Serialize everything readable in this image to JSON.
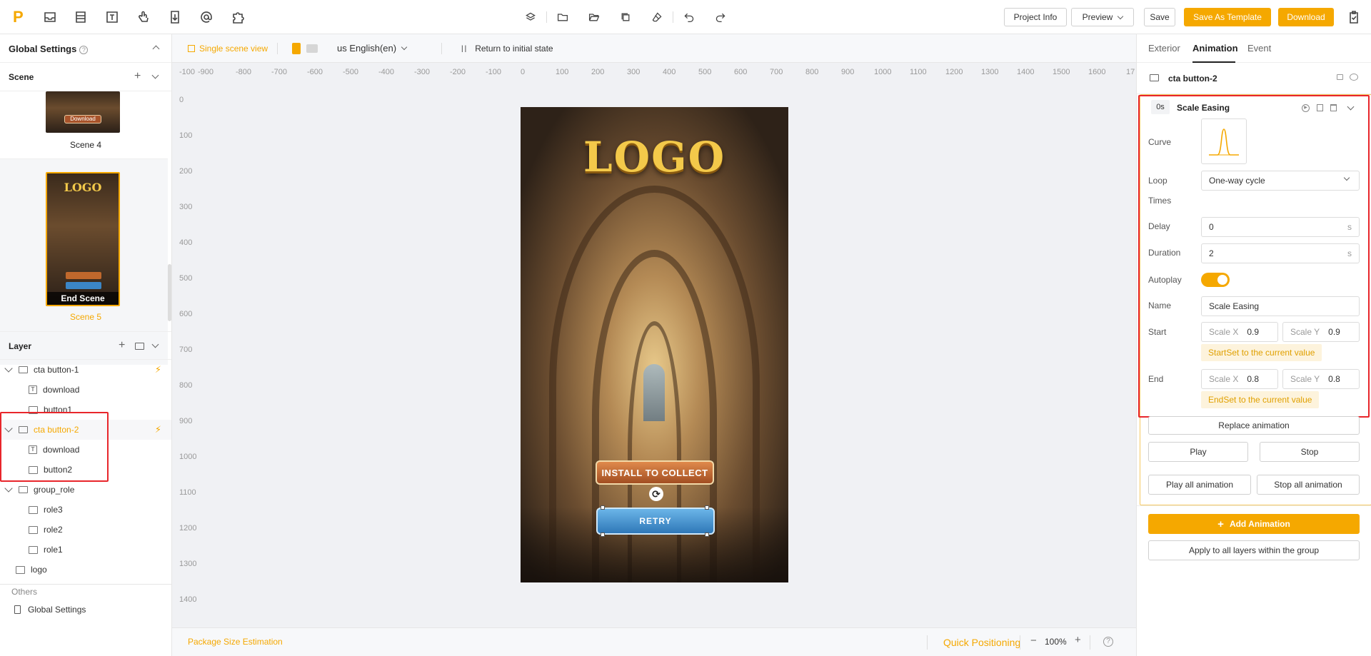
{
  "topbar": {
    "logo": "P",
    "project_info": "Project Info",
    "preview": "Preview",
    "save": "Save",
    "save_as_template": "Save As Template",
    "download": "Download"
  },
  "left": {
    "global_settings": "Global Settings",
    "scene_header": "Scene",
    "scenes": [
      {
        "label": "Scene 4",
        "badge": "Download"
      },
      {
        "label": "Scene 5",
        "badge": "End Scene",
        "logo": "LOGO"
      }
    ],
    "layer_header": "Layer",
    "layers": [
      {
        "label": "cta button-1"
      },
      {
        "label": "download"
      },
      {
        "label": "button1"
      },
      {
        "label": "cta button-2"
      },
      {
        "label": "download"
      },
      {
        "label": "button2"
      },
      {
        "label": "group_role"
      },
      {
        "label": "role3"
      },
      {
        "label": "role2"
      },
      {
        "label": "role1"
      },
      {
        "label": "logo"
      }
    ],
    "others_header": "Others",
    "others_item": "Global Settings"
  },
  "canvas": {
    "single_scene_view": "Single scene view",
    "language": "us English(en)",
    "return_initial": "Return to initial state",
    "ruler_h": [
      "-100",
      "-900",
      "-800",
      "-700",
      "-600",
      "-500",
      "-400",
      "-300",
      "-200",
      "-100",
      "0",
      "100",
      "200",
      "300",
      "400",
      "500",
      "600",
      "700",
      "800",
      "900",
      "1000",
      "1100",
      "1200",
      "1300",
      "1400",
      "1500",
      "1600",
      "17"
    ],
    "ruler_v": [
      "0",
      "100",
      "200",
      "300",
      "400",
      "500",
      "600",
      "700",
      "800",
      "900",
      "1000",
      "1100",
      "1200",
      "1300",
      "1400"
    ],
    "phone_logo": "LOGO",
    "install_btn": "INSTALL TO COLLECT",
    "retry_btn": "RETRY",
    "package_size": "Package Size Estimation",
    "quick_positioning": "Quick Positioning",
    "zoom": "100%"
  },
  "right": {
    "tabs": [
      "Exterior",
      "Animation",
      "Event"
    ],
    "layer_name": "cta button-2",
    "anim_time": "0s",
    "anim_title": "Scale Easing",
    "curve_label": "Curve",
    "loop_label": "Loop",
    "times_label": "Times",
    "loop_value": "One-way cycle",
    "delay_label": "Delay",
    "delay_value": "0",
    "duration_label": "Duration",
    "duration_value": "2",
    "unit_s": "s",
    "autoplay_label": "Autoplay",
    "name_label": "Name",
    "name_value": "Scale Easing",
    "start_label": "Start",
    "end_label": "End",
    "scale_x": "Scale X",
    "scale_y": "Scale Y",
    "start_x": "0.9",
    "start_y": "0.9",
    "end_x": "0.8",
    "end_y": "0.8",
    "start_hint": "StartSet to the current value",
    "end_hint": "EndSet to the current value",
    "replace_animation": "Replace animation",
    "play": "Play",
    "stop": "Stop",
    "play_all": "Play all animation",
    "stop_all": "Stop all animation",
    "add_animation": "Add Animation",
    "apply_all": "Apply to all layers within the group"
  },
  "colors": {
    "accent": "#f5a800",
    "highlight": "#e8262b"
  }
}
